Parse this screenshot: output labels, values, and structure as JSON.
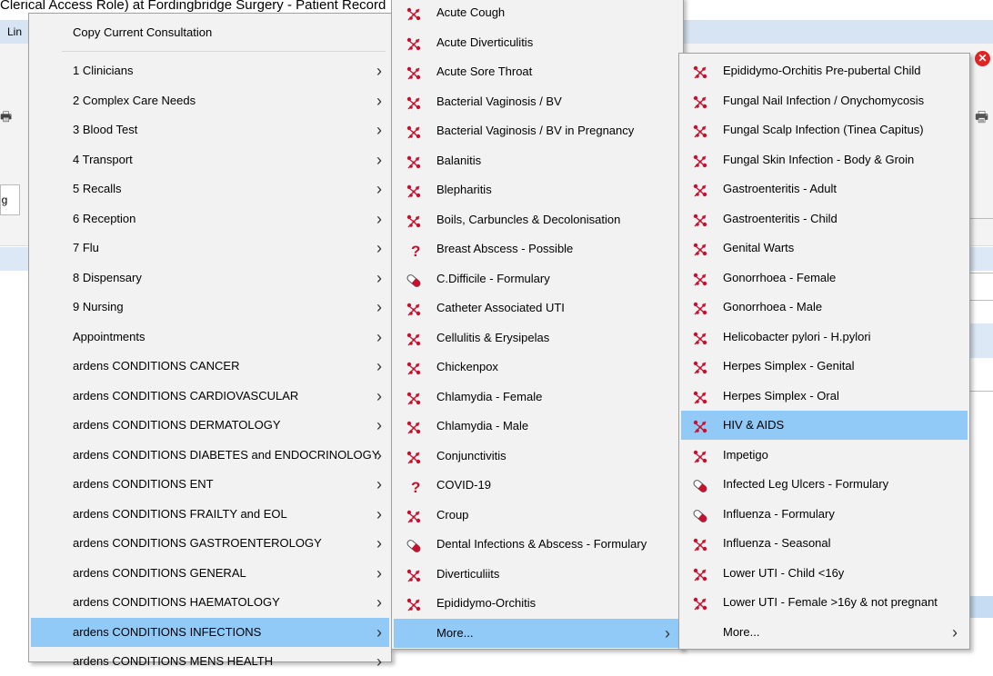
{
  "window": {
    "title": "Clerical Access Role) at Fordingbridge Surgery - Patient Record",
    "menu_fragment": "Lin",
    "field_fragment": "ng"
  },
  "colors": {
    "highlight": "#91c9f7",
    "menu_bg": "#f2f2f2",
    "icon_red": "#c8102e"
  },
  "menu1": {
    "copy_label": "Copy Current Consultation",
    "items": [
      {
        "label": "1 Clinicians"
      },
      {
        "label": "2 Complex Care Needs"
      },
      {
        "label": "3 Blood Test"
      },
      {
        "label": "4 Transport"
      },
      {
        "label": "5 Recalls"
      },
      {
        "label": "6 Reception"
      },
      {
        "label": "7 Flu"
      },
      {
        "label": "8 Dispensary"
      },
      {
        "label": "9 Nursing"
      },
      {
        "label": "Appointments"
      },
      {
        "label": "ardens CONDITIONS CANCER"
      },
      {
        "label": "ardens CONDITIONS CARDIOVASCULAR"
      },
      {
        "label": "ardens CONDITIONS DERMATOLOGY"
      },
      {
        "label": "ardens CONDITIONS DIABETES and ENDOCRINOLOGY"
      },
      {
        "label": "ardens CONDITIONS ENT"
      },
      {
        "label": "ardens CONDITIONS FRAILTY and EOL"
      },
      {
        "label": "ardens CONDITIONS GASTROENTEROLOGY"
      },
      {
        "label": "ardens CONDITIONS GENERAL"
      },
      {
        "label": "ardens CONDITIONS HAEMATOLOGY"
      },
      {
        "label": "ardens CONDITIONS INFECTIONS",
        "selected": true
      },
      {
        "label": "ardens CONDITIONS MENS HEALTH"
      }
    ]
  },
  "menu2": {
    "items": [
      {
        "label": "Acute Cough",
        "icon": "virus-icon"
      },
      {
        "label": "Acute Diverticulitis",
        "icon": "virus-icon"
      },
      {
        "label": "Acute Sore Throat",
        "icon": "virus-icon"
      },
      {
        "label": "Bacterial Vaginosis / BV",
        "icon": "virus-icon"
      },
      {
        "label": "Bacterial Vaginosis / BV in Pregnancy",
        "icon": "virus-icon"
      },
      {
        "label": "Balanitis",
        "icon": "virus-icon"
      },
      {
        "label": "Blepharitis",
        "icon": "virus-icon"
      },
      {
        "label": "Boils, Carbuncles & Decolonisation",
        "icon": "virus-icon"
      },
      {
        "label": "Breast Abscess - Possible",
        "icon": "question-icon"
      },
      {
        "label": "C.Difficile - Formulary",
        "icon": "pill-icon"
      },
      {
        "label": "Catheter Associated UTI",
        "icon": "virus-icon"
      },
      {
        "label": "Cellulitis & Erysipelas",
        "icon": "virus-icon"
      },
      {
        "label": "Chickenpox",
        "icon": "virus-icon"
      },
      {
        "label": "Chlamydia - Female",
        "icon": "virus-icon"
      },
      {
        "label": "Chlamydia - Male",
        "icon": "virus-icon"
      },
      {
        "label": "Conjunctivitis",
        "icon": "virus-icon"
      },
      {
        "label": "COVID-19",
        "icon": "question-icon"
      },
      {
        "label": "Croup",
        "icon": "virus-icon"
      },
      {
        "label": "Dental Infections & Abscess - Formulary",
        "icon": "pill-icon"
      },
      {
        "label": "Diverticuliits",
        "icon": "virus-icon"
      },
      {
        "label": "Epididymo-Orchitis",
        "icon": "virus-icon"
      }
    ],
    "more_label": "More..."
  },
  "menu3": {
    "items": [
      {
        "label": "Epididymo-Orchitis Pre-pubertal Child",
        "icon": "virus-icon"
      },
      {
        "label": "Fungal Nail Infection / Onychomycosis",
        "icon": "virus-icon"
      },
      {
        "label": "Fungal Scalp Infection (Tinea Capitus)",
        "icon": "virus-icon"
      },
      {
        "label": "Fungal Skin Infection - Body & Groin",
        "icon": "virus-icon"
      },
      {
        "label": "Gastroenteritis - Adult",
        "icon": "virus-icon"
      },
      {
        "label": "Gastroenteritis - Child",
        "icon": "virus-icon"
      },
      {
        "label": "Genital Warts",
        "icon": "virus-icon"
      },
      {
        "label": "Gonorrhoea - Female",
        "icon": "virus-icon"
      },
      {
        "label": "Gonorrhoea - Male",
        "icon": "virus-icon"
      },
      {
        "label": "Helicobacter pylori - H.pylori",
        "icon": "virus-icon"
      },
      {
        "label": "Herpes Simplex - Genital",
        "icon": "virus-icon"
      },
      {
        "label": "Herpes Simplex - Oral",
        "icon": "virus-icon"
      },
      {
        "label": "HIV & AIDS",
        "icon": "virus-icon",
        "selected": true
      },
      {
        "label": "Impetigo",
        "icon": "virus-icon"
      },
      {
        "label": "Infected Leg Ulcers - Formulary",
        "icon": "pill-icon"
      },
      {
        "label": "Influenza - Formulary",
        "icon": "pill-icon"
      },
      {
        "label": "Influenza - Seasonal",
        "icon": "virus-icon"
      },
      {
        "label": "Lower UTI - Child <16y",
        "icon": "virus-icon"
      },
      {
        "label": "Lower UTI - Female >16y & not pregnant",
        "icon": "virus-icon"
      }
    ],
    "more_label": "More..."
  }
}
